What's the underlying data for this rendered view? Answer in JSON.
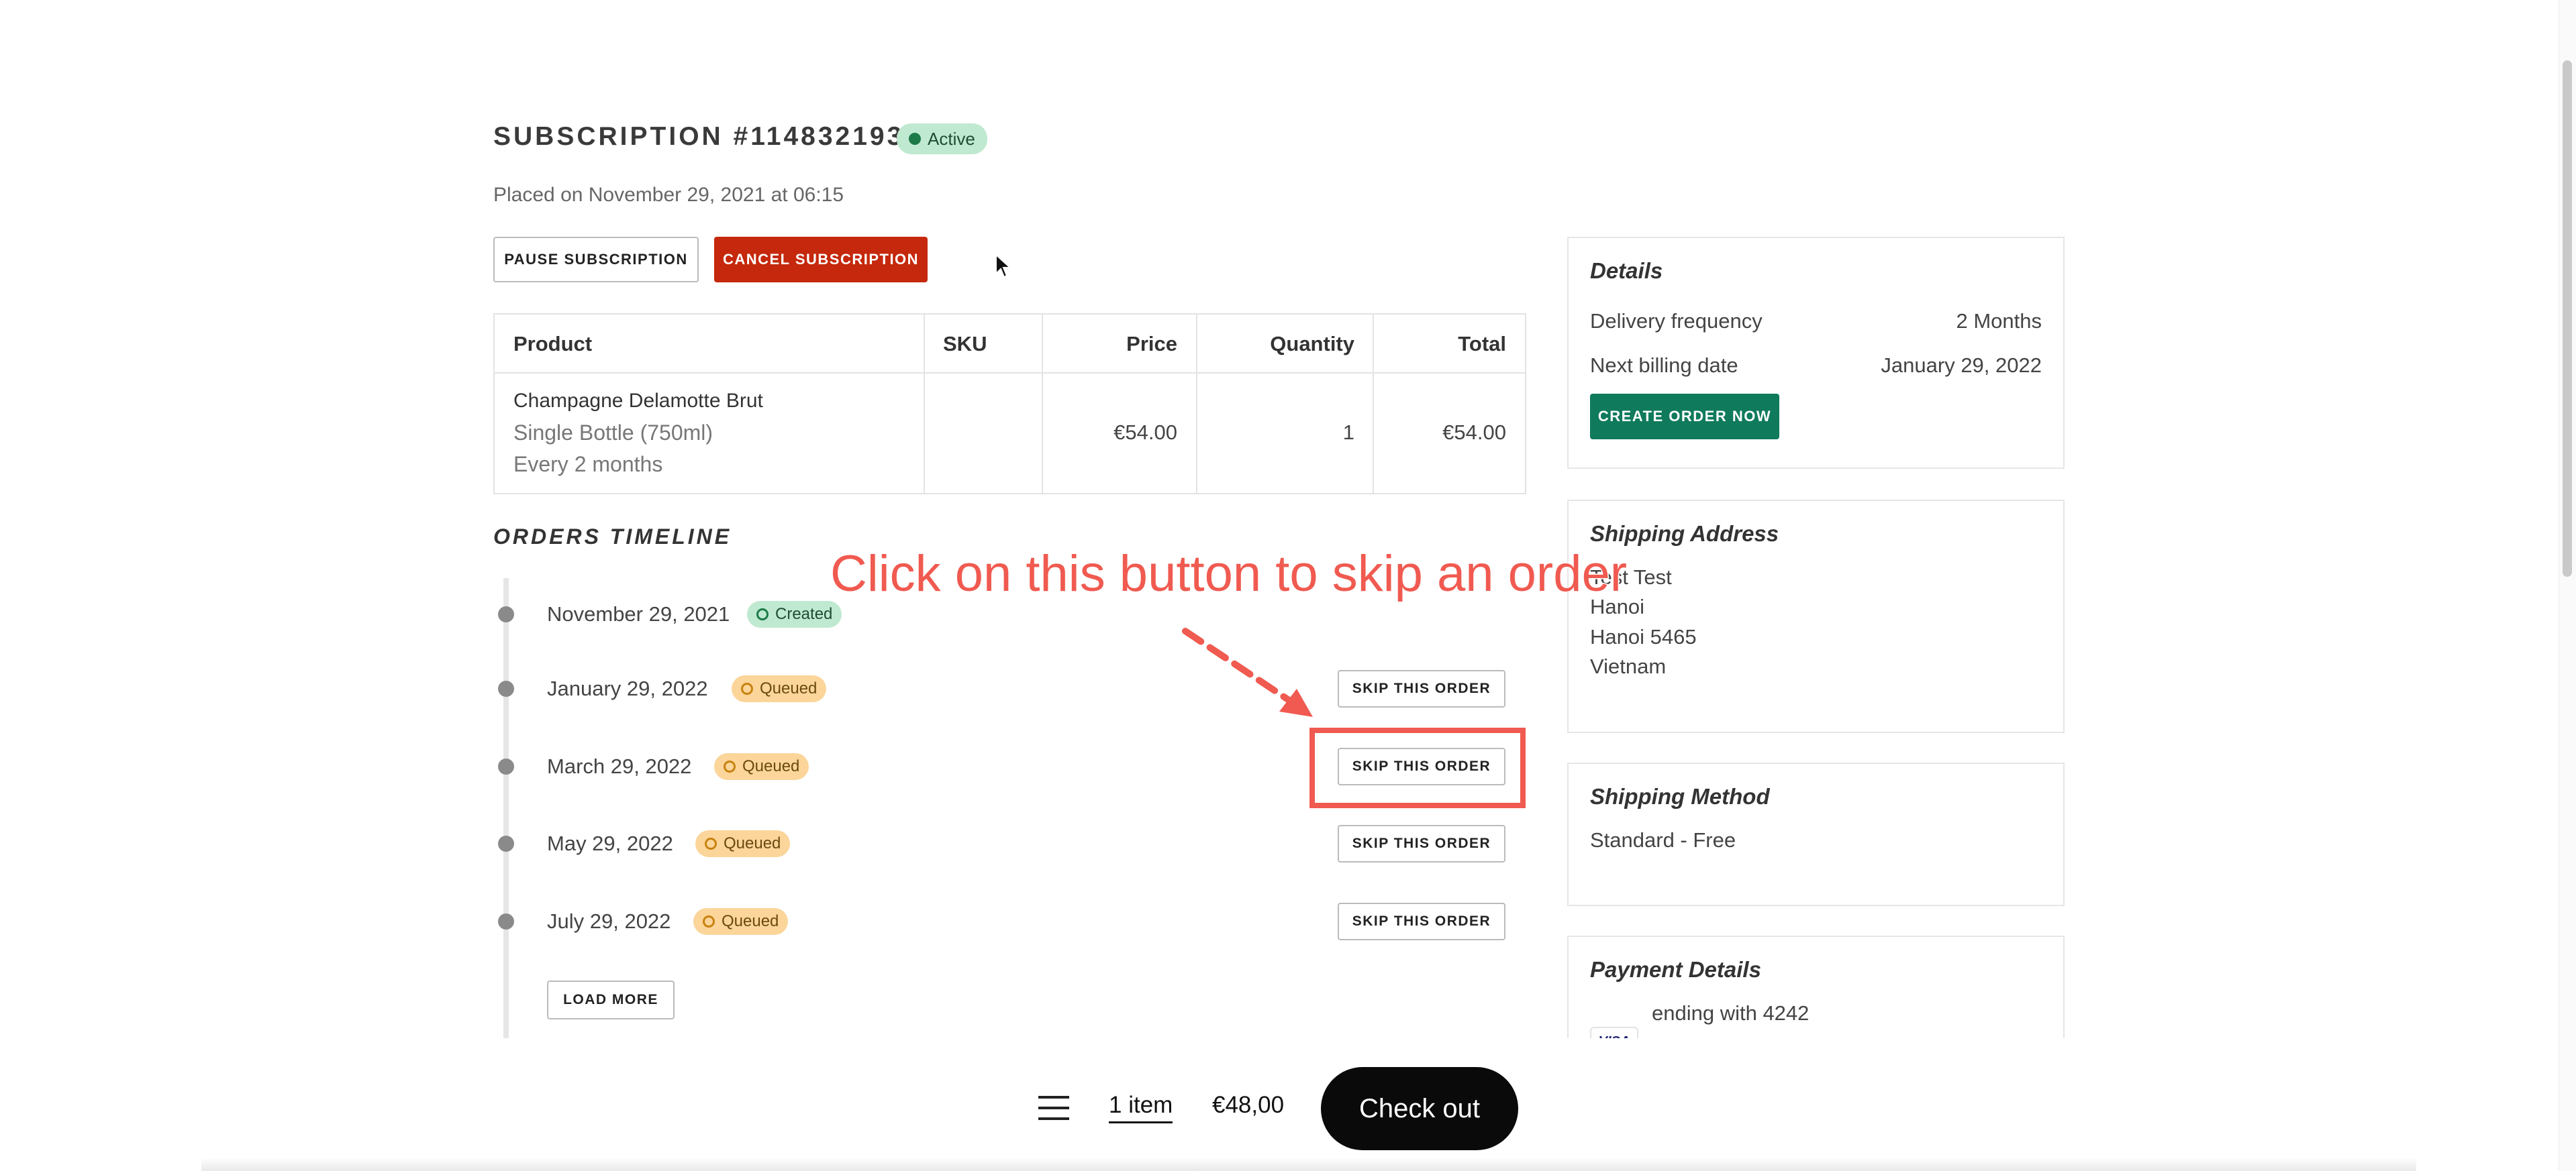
{
  "subscription": {
    "title": "SUBSCRIPTION #1148321931",
    "status": "Active",
    "placed": "Placed on November 29, 2021 at 06:15",
    "pause_label": "PAUSE SUBSCRIPTION",
    "cancel_label": "CANCEL SUBSCRIPTION"
  },
  "table": {
    "headers": [
      "Product",
      "SKU",
      "Price",
      "Quantity",
      "Total"
    ],
    "rows": [
      {
        "product_name": "Champagne Delamotte Brut",
        "variant": "Single Bottle (750ml)",
        "frequency": "Every 2 months",
        "sku": "",
        "price": "€54.00",
        "quantity": "1",
        "total": "€54.00"
      }
    ]
  },
  "timeline": {
    "title": "ORDERS TIMELINE",
    "entries": [
      {
        "date": "November 29, 2021",
        "status": "Created"
      },
      {
        "date": "January 29, 2022",
        "status": "Queued",
        "action": "SKIP THIS ORDER"
      },
      {
        "date": "March 29, 2022",
        "status": "Queued",
        "action": "SKIP THIS ORDER"
      },
      {
        "date": "May 29, 2022",
        "status": "Queued",
        "action": "SKIP THIS ORDER"
      },
      {
        "date": "July 29, 2022",
        "status": "Queued",
        "action": "SKIP THIS ORDER"
      }
    ],
    "load_more": "LOAD MORE"
  },
  "annotation": {
    "text": "Click on this button to skip an order",
    "color": "#f05a50"
  },
  "details": {
    "title": "Details",
    "rows": [
      {
        "label": "Delivery frequency",
        "value": "2 Months"
      },
      {
        "label": "Next billing date",
        "value": "January 29, 2022"
      }
    ],
    "create_label": "CREATE ORDER NOW"
  },
  "shipping_address": {
    "title": "Shipping Address",
    "lines": [
      "Test Test",
      "Hanoi",
      "Hanoi 5465",
      "Vietnam"
    ]
  },
  "shipping_method": {
    "title": "Shipping Method",
    "value": "Standard - Free"
  },
  "payment": {
    "title": "Payment Details",
    "card_brand": "VISA",
    "card_text": "ending with 4242"
  },
  "cart": {
    "items": "1 item",
    "price": "€48,00",
    "checkout_label": "Check out"
  },
  "colors": {
    "cancel": "#c5280c",
    "create": "#0f7a5c",
    "active_badge": "#bfe9d0",
    "queued_badge": "#fbd59a"
  }
}
